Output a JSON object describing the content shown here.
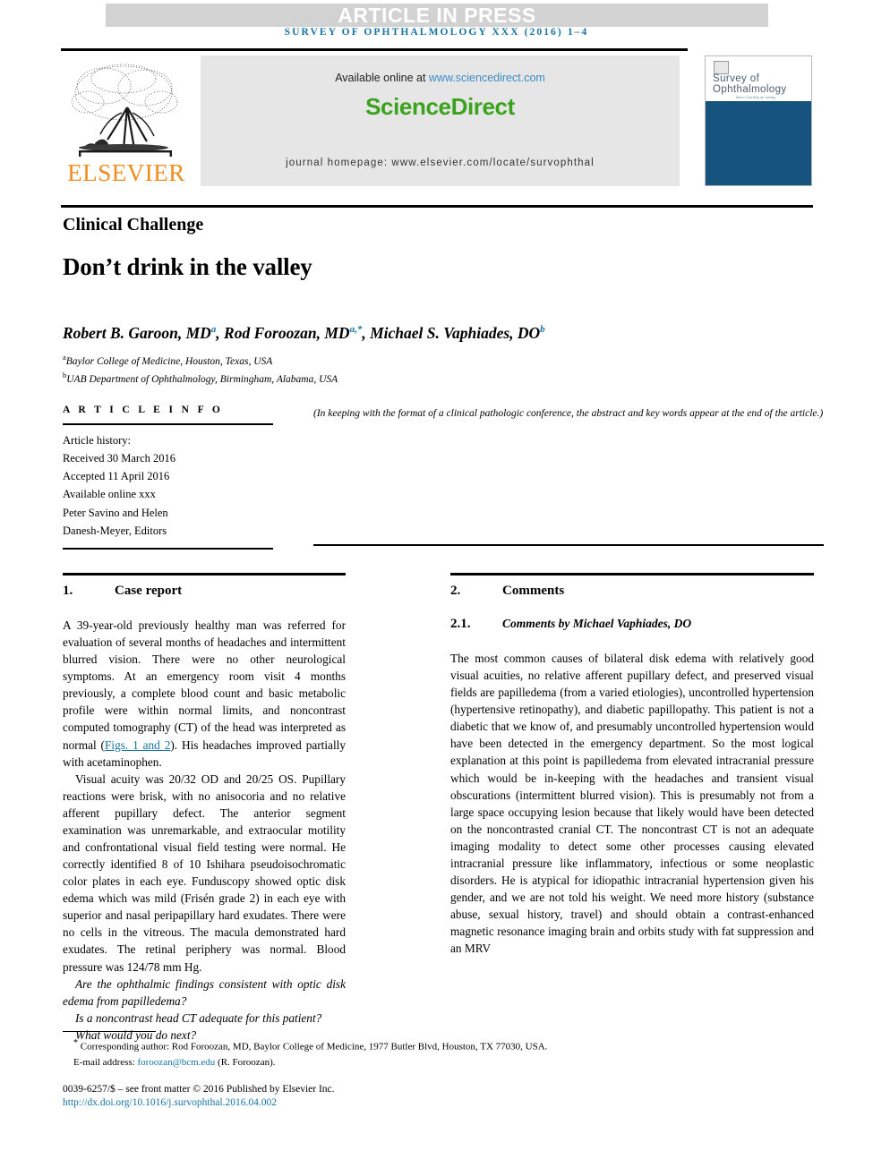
{
  "banner": {
    "article_in_press": "ARTICLE IN PRESS",
    "running_head": "SURVEY OF OPHTHALMOLOGY XXX (2016) 1–4"
  },
  "header": {
    "publisher_name": "ELSEVIER",
    "available_online_prefix": "Available online at ",
    "sciencedirect_url": "www.sciencedirect.com",
    "sciencedirect_logo": "ScienceDirect",
    "journal_homepage": "journal homepage: www.elsevier.com/locate/survophthal",
    "cover": {
      "line1": "Survey of",
      "line2": "Ophthalmology",
      "subline": "Moun Cyd Bay an Inmag"
    },
    "colors": {
      "sciencedirect_green": "#3aa21c",
      "link_blue": "#3b8cc4",
      "elsevier_orange": "#F08C1E",
      "cover_navy": "#17537f",
      "accent_blue": "#1573a6"
    }
  },
  "title_block": {
    "section_kind": "Clinical Challenge",
    "title": "Don’t drink in the valley",
    "authors": [
      {
        "name": "Robert B. Garoon, MD",
        "marks": "a"
      },
      {
        "name": "Rod Foroozan, MD",
        "marks": "a,*"
      },
      {
        "name": "Michael S. Vaphiades, DO",
        "marks": "b"
      }
    ],
    "affiliations": [
      {
        "mark": "a",
        "text": "Baylor College of Medicine, Houston, Texas, USA"
      },
      {
        "mark": "b",
        "text": "UAB Department of Ophthalmology, Birmingham, Alabama, USA"
      }
    ]
  },
  "article_info": {
    "heading": "A R T I C L E  I N F O",
    "history_label": "Article history:",
    "received": "Received 30 March 2016",
    "accepted": "Accepted 11 April 2016",
    "available_online": "Available online xxx",
    "editors_line1": "Peter Savino and Helen",
    "editors_line2": "Danesh-Meyer, Editors",
    "note": "(In keeping with the format of a clinical pathologic conference, the abstract and key words appear at the end of the article.)"
  },
  "sections": {
    "case_report": {
      "number": "1.",
      "title": "Case report",
      "para1_a": "A 39-year-old previously healthy man was referred for evaluation of several months of headaches and intermittent blurred vision. There were no other neurological symptoms. At an emergency room visit 4 months previously, a complete blood count and basic metabolic profile were within normal limits, and noncontrast computed tomography (CT) of the head was interpreted as normal (",
      "para1_link": "Figs. 1 and 2",
      "para1_b": "). His headaches improved partially with acetaminophen.",
      "para2": "Visual acuity was 20/32 OD and 20/25 OS. Pupillary reactions were brisk, with no anisocoria and no relative afferent pupillary defect. The anterior segment examination was unremarkable, and extraocular motility and confrontational visual field testing were normal. He correctly identified 8 of 10 Ishihara pseudoisochromatic color plates in each eye. Funduscopy showed optic disk edema which was mild (Frisén grade 2) in each eye with superior and nasal peripapillary hard exudates. There were no cells in the vitreous. The macula demonstrated hard exudates. The retinal periphery was normal. Blood pressure was 124/78 mm Hg.",
      "question1": "Are the ophthalmic findings consistent with optic disk edema from papilledema?",
      "question2": "Is a noncontrast head CT adequate for this patient?",
      "question3": "What would you do next?"
    },
    "comments": {
      "number": "2.",
      "title": "Comments",
      "sub_number": "2.1.",
      "sub_title": "Comments by Michael Vaphiades, DO",
      "para1": "The most common causes of bilateral disk edema with relatively good visual acuities, no relative afferent pupillary defect, and preserved visual fields are papilledema (from a varied etiologies), uncontrolled hypertension (hypertensive retinopathy), and diabetic papillopathy. This patient is not a diabetic that we know of, and presumably uncontrolled hypertension would have been detected in the emergency department. So the most logical explanation at this point is papilledema from elevated intracranial pressure which would be in-keeping with the headaches and transient visual obscurations (intermittent blurred vision). This is presumably not from a large space occupying lesion because that likely would have been detected on the noncontrasted cranial CT. The noncontrast CT is not an adequate imaging modality to detect some other processes causing elevated intracranial pressure like inflammatory, infectious or some neoplastic disorders. He is atypical for idiopathic intracranial hypertension given his gender, and we are not told his weight. We need more history (substance abuse, sexual history, travel) and should obtain a contrast-enhanced magnetic resonance imaging brain and orbits study with fat suppression and an MRV"
    }
  },
  "footer": {
    "corresponding_author": "Corresponding author: Rod Foroozan, MD, Baylor College of Medicine, 1977 Butler Blvd, Houston, TX 77030, USA.",
    "email_label": "E-mail address: ",
    "email": "foroozan@bcm.edu",
    "email_suffix": " (R. Foroozan).",
    "copyright": "0039-6257/$ – see front matter © 2016 Published by Elsevier Inc.",
    "doi": "http://dx.doi.org/10.1016/j.survophthal.2016.04.002"
  }
}
